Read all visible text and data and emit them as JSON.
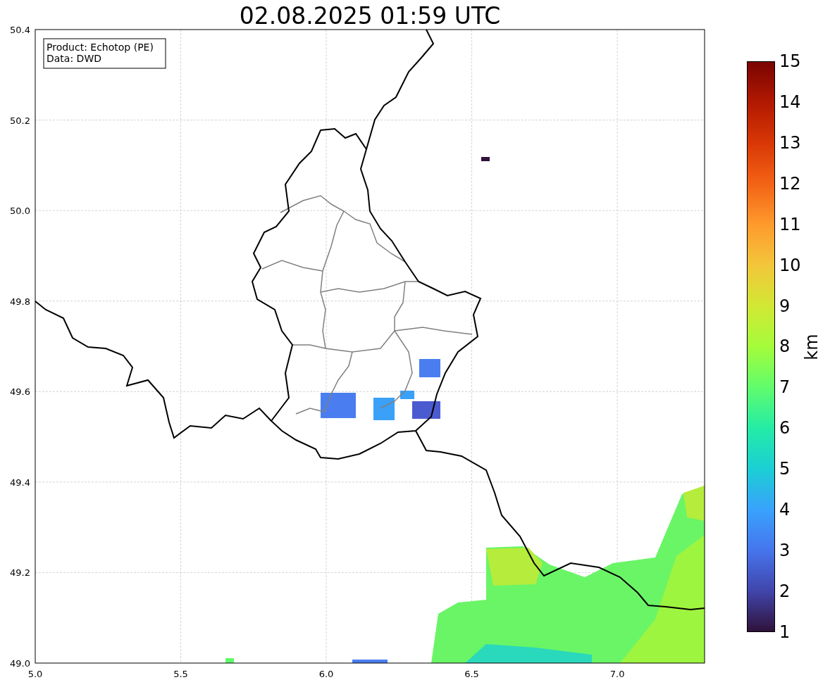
{
  "title": "02.08.2025 01:59 UTC",
  "legend_lines": [
    "Product: Echotop (PE)",
    "Data: DWD"
  ],
  "x_ticks": [
    "5.0",
    "5.5",
    "6.0",
    "6.5",
    "7.0"
  ],
  "y_ticks": [
    "50.4",
    "50.2",
    "50.0",
    "49.8",
    "49.6",
    "49.4",
    "49.2",
    "49.0"
  ],
  "colorbar": {
    "label": "km",
    "ticks": [
      "15",
      "14",
      "13",
      "12",
      "11",
      "10",
      "9",
      "8",
      "7",
      "6",
      "5",
      "4",
      "3",
      "2",
      "1"
    ]
  }
}
